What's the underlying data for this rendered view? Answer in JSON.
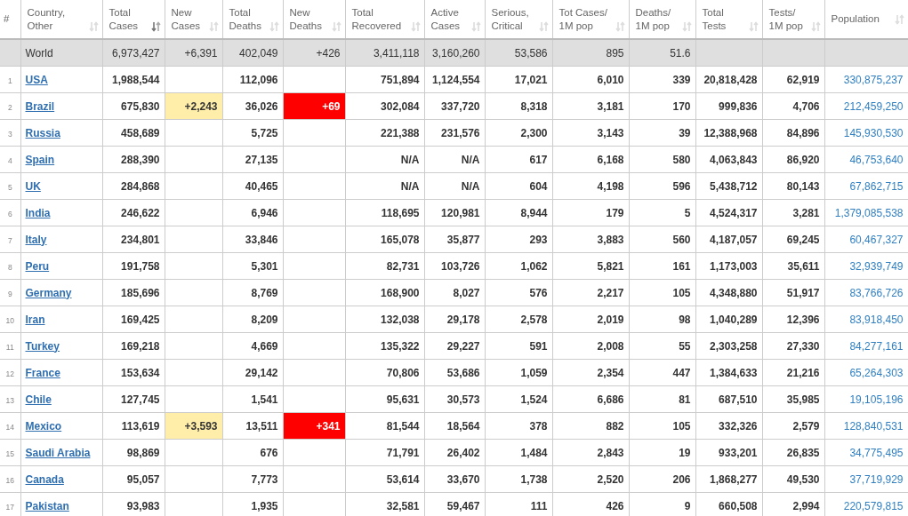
{
  "table": {
    "columns": [
      {
        "label": "#",
        "kind": "rank"
      },
      {
        "label": "Country, Other",
        "kind": "country",
        "sorted": false
      },
      {
        "label": "Total Cases",
        "kind": "number",
        "sorted": true
      },
      {
        "label": "New Cases",
        "kind": "new_cases",
        "sorted": false
      },
      {
        "label": "Total Deaths",
        "kind": "number",
        "sorted": false
      },
      {
        "label": "New Deaths",
        "kind": "new_deaths",
        "sorted": false
      },
      {
        "label": "Total Recovered",
        "kind": "number",
        "sorted": false
      },
      {
        "label": "Active Cases",
        "kind": "number",
        "sorted": false
      },
      {
        "label": "Serious, Critical",
        "kind": "number",
        "sorted": false
      },
      {
        "label": "Tot Cases/ 1M pop",
        "kind": "number",
        "sorted": false
      },
      {
        "label": "Deaths/ 1M pop",
        "kind": "number",
        "sorted": false
      },
      {
        "label": "Total Tests",
        "kind": "number",
        "sorted": false
      },
      {
        "label": "Tests/ 1M pop",
        "kind": "number",
        "sorted": false
      },
      {
        "label": "Population",
        "kind": "population",
        "sorted": false
      }
    ],
    "rows": [
      {
        "kind": "total",
        "cells": [
          null,
          "World",
          "6,973,427",
          "+6,391",
          "402,049",
          "+426",
          "3,411,118",
          "3,160,260",
          "53,586",
          "895",
          "51.6",
          null,
          null,
          null
        ]
      },
      {
        "kind": "country",
        "cells": [
          "1",
          "USA",
          "1,988,544",
          null,
          "112,096",
          null,
          "751,894",
          "1,124,554",
          "17,021",
          "6,010",
          "339",
          "20,818,428",
          "62,919",
          "330,875,237"
        ]
      },
      {
        "kind": "country",
        "cells": [
          "2",
          "Brazil",
          "675,830",
          "+2,243",
          "36,026",
          "+69",
          "302,084",
          "337,720",
          "8,318",
          "3,181",
          "170",
          "999,836",
          "4,706",
          "212,459,250"
        ]
      },
      {
        "kind": "country",
        "cells": [
          "3",
          "Russia",
          "458,689",
          null,
          "5,725",
          null,
          "221,388",
          "231,576",
          "2,300",
          "3,143",
          "39",
          "12,388,968",
          "84,896",
          "145,930,530"
        ]
      },
      {
        "kind": "country",
        "cells": [
          "4",
          "Spain",
          "288,390",
          null,
          "27,135",
          null,
          "N/A",
          "N/A",
          "617",
          "6,168",
          "580",
          "4,063,843",
          "86,920",
          "46,753,640"
        ]
      },
      {
        "kind": "country",
        "cells": [
          "5",
          "UK",
          "284,868",
          null,
          "40,465",
          null,
          "N/A",
          "N/A",
          "604",
          "4,198",
          "596",
          "5,438,712",
          "80,143",
          "67,862,715"
        ]
      },
      {
        "kind": "country",
        "cells": [
          "6",
          "India",
          "246,622",
          null,
          "6,946",
          null,
          "118,695",
          "120,981",
          "8,944",
          "179",
          "5",
          "4,524,317",
          "3,281",
          "1,379,085,538"
        ]
      },
      {
        "kind": "country",
        "cells": [
          "7",
          "Italy",
          "234,801",
          null,
          "33,846",
          null,
          "165,078",
          "35,877",
          "293",
          "3,883",
          "560",
          "4,187,057",
          "69,245",
          "60,467,327"
        ]
      },
      {
        "kind": "country",
        "cells": [
          "8",
          "Peru",
          "191,758",
          null,
          "5,301",
          null,
          "82,731",
          "103,726",
          "1,062",
          "5,821",
          "161",
          "1,173,003",
          "35,611",
          "32,939,749"
        ]
      },
      {
        "kind": "country",
        "cells": [
          "9",
          "Germany",
          "185,696",
          null,
          "8,769",
          null,
          "168,900",
          "8,027",
          "576",
          "2,217",
          "105",
          "4,348,880",
          "51,917",
          "83,766,726"
        ]
      },
      {
        "kind": "country",
        "cells": [
          "10",
          "Iran",
          "169,425",
          null,
          "8,209",
          null,
          "132,038",
          "29,178",
          "2,578",
          "2,019",
          "98",
          "1,040,289",
          "12,396",
          "83,918,450"
        ]
      },
      {
        "kind": "country",
        "cells": [
          "11",
          "Turkey",
          "169,218",
          null,
          "4,669",
          null,
          "135,322",
          "29,227",
          "591",
          "2,008",
          "55",
          "2,303,258",
          "27,330",
          "84,277,161"
        ]
      },
      {
        "kind": "country",
        "cells": [
          "12",
          "France",
          "153,634",
          null,
          "29,142",
          null,
          "70,806",
          "53,686",
          "1,059",
          "2,354",
          "447",
          "1,384,633",
          "21,216",
          "65,264,303"
        ]
      },
      {
        "kind": "country",
        "cells": [
          "13",
          "Chile",
          "127,745",
          null,
          "1,541",
          null,
          "95,631",
          "30,573",
          "1,524",
          "6,686",
          "81",
          "687,510",
          "35,985",
          "19,105,196"
        ]
      },
      {
        "kind": "country",
        "cells": [
          "14",
          "Mexico",
          "113,619",
          "+3,593",
          "13,511",
          "+341",
          "81,544",
          "18,564",
          "378",
          "882",
          "105",
          "332,326",
          "2,579",
          "128,840,531"
        ]
      },
      {
        "kind": "country",
        "cells": [
          "15",
          "Saudi Arabia",
          "98,869",
          null,
          "676",
          null,
          "71,791",
          "26,402",
          "1,484",
          "2,843",
          "19",
          "933,201",
          "26,835",
          "34,775,495"
        ]
      },
      {
        "kind": "country",
        "cells": [
          "16",
          "Canada",
          "95,057",
          null,
          "7,773",
          null,
          "53,614",
          "33,670",
          "1,738",
          "2,520",
          "206",
          "1,868,277",
          "49,530",
          "37,719,929"
        ]
      },
      {
        "kind": "country",
        "cells": [
          "17",
          "Pakistan",
          "93,983",
          null,
          "1,935",
          null,
          "32,581",
          "59,467",
          "111",
          "426",
          "9",
          "660,508",
          "2,994",
          "220,579,815"
        ]
      }
    ]
  }
}
